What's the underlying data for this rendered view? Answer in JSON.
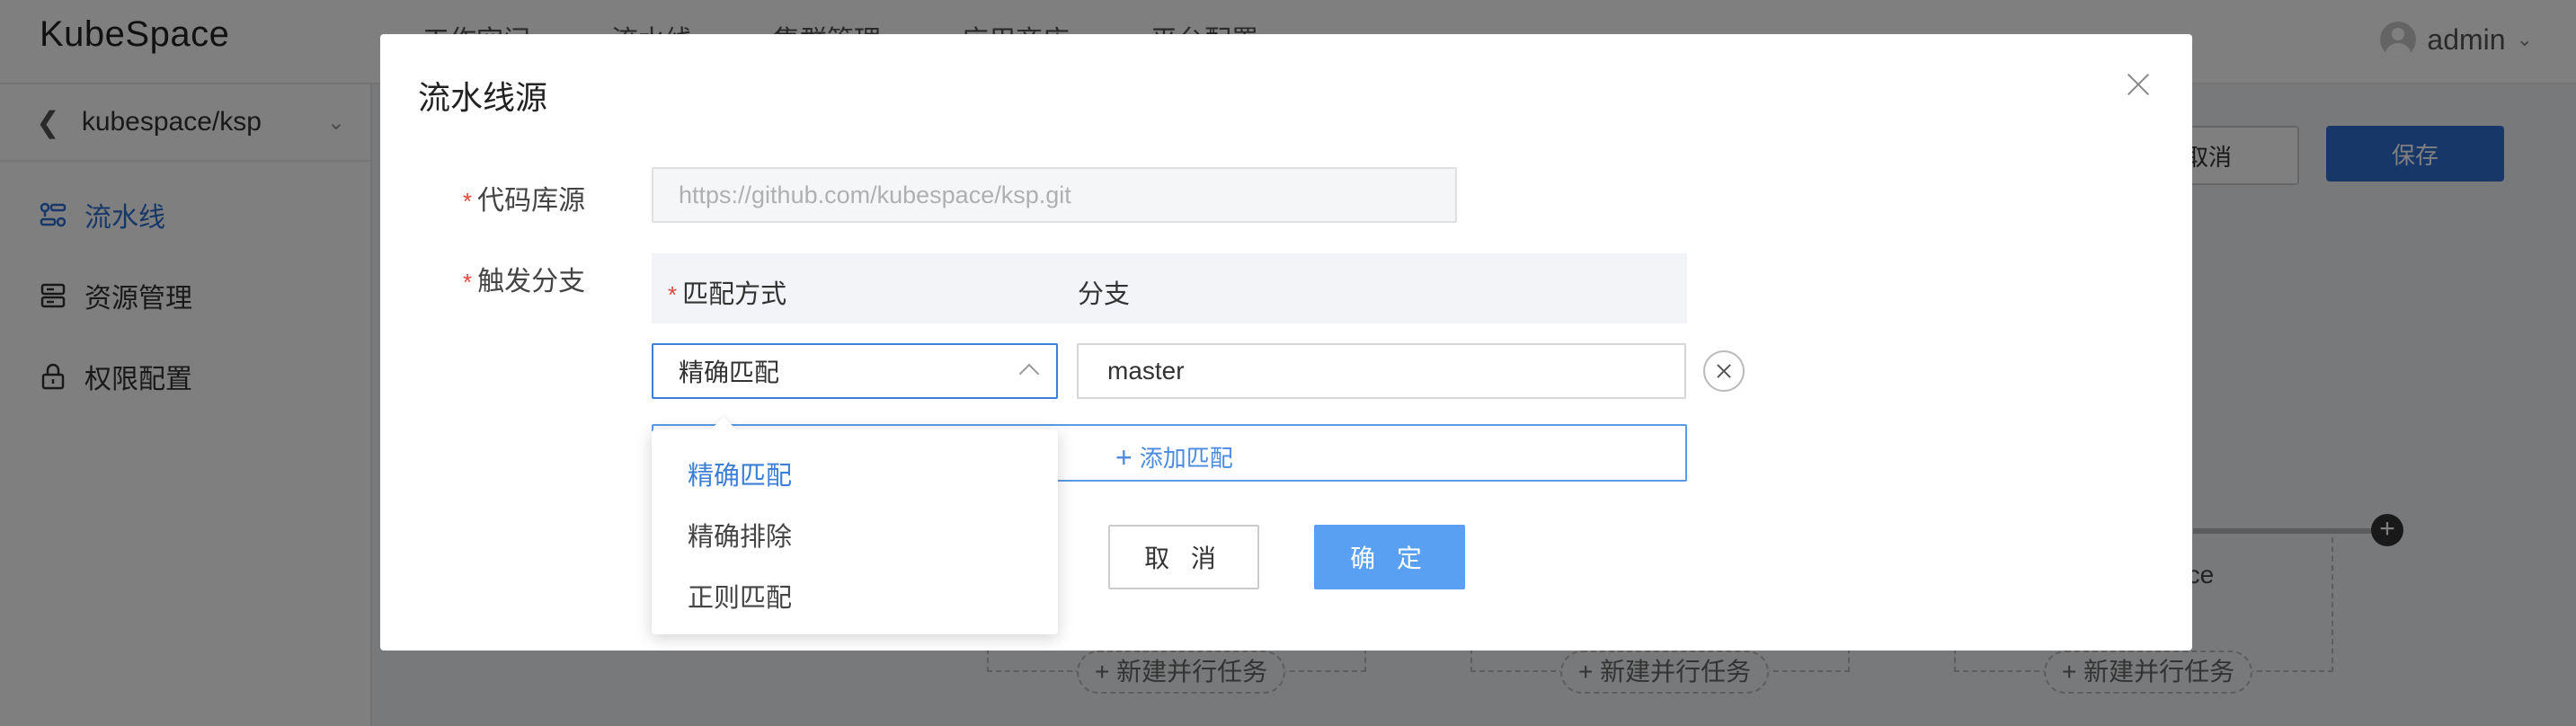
{
  "app": {
    "logo": "KubeSpace",
    "user": "admin"
  },
  "topnav": [
    "工作空间",
    "流水线",
    "集群管理",
    "应用商店",
    "平台配置"
  ],
  "sidebar": {
    "project": "kubespace/ksp",
    "items": [
      {
        "label": "流水线",
        "icon": "pipeline-icon"
      },
      {
        "label": "资源管理",
        "icon": "server-icon"
      },
      {
        "label": "权限配置",
        "icon": "lock-icon"
      }
    ]
  },
  "page_actions": {
    "cancel": "取消",
    "save": "保存"
  },
  "pipeline": {
    "new_task": "+ 新建并行任务",
    "stage_fragment": "ace"
  },
  "modal": {
    "title": "流水线源",
    "repo_label": "代码库源",
    "repo_placeholder": "https://github.com/kubespace/ksp.git",
    "trigger_label": "触发分支",
    "col_match": "匹配方式",
    "col_branch": "分支",
    "row": {
      "match": "精确匹配",
      "branch": "master"
    },
    "add_match": "添加匹配",
    "cancel": "取 消",
    "confirm": "确 定",
    "required_mark": "*"
  },
  "dropdown": {
    "options": [
      "精确匹配",
      "精确排除",
      "正则匹配"
    ],
    "selected": "精确匹配"
  },
  "colors": {
    "primary": "#2f6fd1",
    "primary_light": "#5aa0f2",
    "required": "#e4473c"
  }
}
